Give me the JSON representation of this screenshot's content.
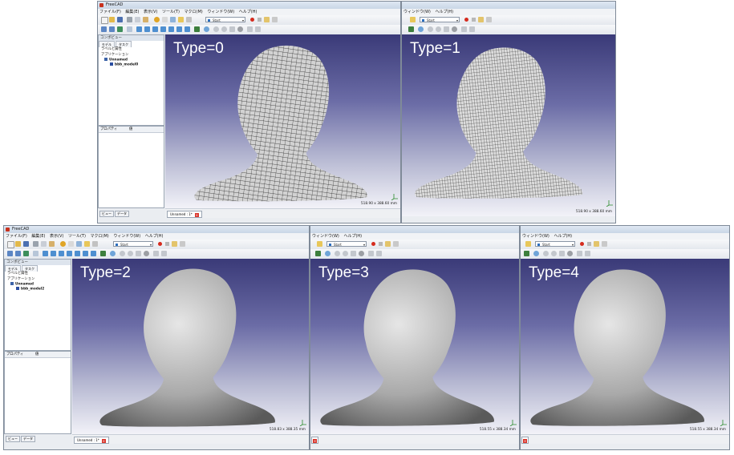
{
  "app": {
    "title": "FreeCAD",
    "menus": [
      "ファイル(F)",
      "編集(E)",
      "表示(V)",
      "ツール(T)",
      "マクロ(M)",
      "ウィンドウ(W)",
      "ヘルプ(H)"
    ],
    "menus_right": [
      "ウィンドウ(W)",
      "ヘルプ(H)"
    ],
    "workbench": "Start"
  },
  "combo_view": {
    "title": "コンボビュー",
    "tabs": [
      "モデル",
      "タスク"
    ],
    "labels_header": "ラベルと属性",
    "application": "アプリケーション",
    "document": "Unnamed",
    "object_top": "bbb_model0",
    "object_bottom": "bbb_model2",
    "property_header": "プロパティ",
    "value_header": "値",
    "bottom_tabs": [
      "ビュー",
      "データ"
    ]
  },
  "views": [
    {
      "type_label": "Type=0",
      "dims": "518.90 x 388.60 mm",
      "doc_tab": "Unnamed : 1*"
    },
    {
      "type_label": "Type=1",
      "dims": "518.90 x 388.60 mm"
    },
    {
      "type_label": "Type=2",
      "dims": "518.83 x 388.35 mm",
      "doc_tab": "Unnamed : 1*"
    },
    {
      "type_label": "Type=3",
      "dims": "518.55 x 388.34 mm"
    },
    {
      "type_label": "Type=4",
      "dims": "518.55 x 388.34 mm"
    }
  ],
  "colors": {
    "viewport_top": "#3a3a78",
    "viewport_bottom": "#f2f2f8",
    "record_button": "#d52b1e",
    "close_tab": "#d9342a"
  },
  "icons": [
    "freecad-icon",
    "new-file-icon",
    "open-file-icon",
    "save-icon",
    "zoom-fit-icon",
    "view-front-icon",
    "record-macro-icon",
    "stop-macro-icon",
    "run-macro-icon",
    "axis-cross-icon",
    "close-tab-icon"
  ]
}
